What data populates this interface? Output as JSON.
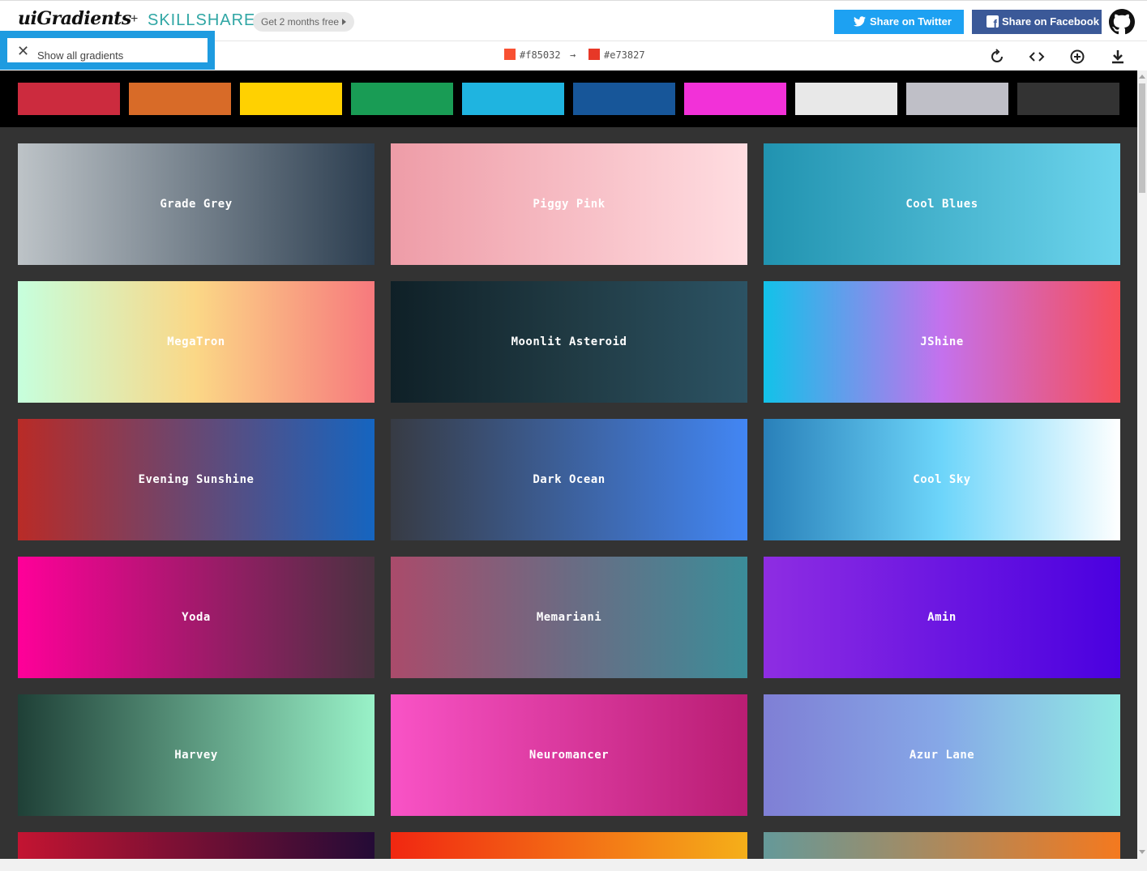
{
  "header": {
    "logo": "uiGradients",
    "plus": "+",
    "partner": "SKILLSHARE",
    "promo": "Get 2 months free",
    "twitter_label": "Share on Twitter",
    "facebook_label": "Share on Facebook"
  },
  "toolbar": {
    "show_all_label": "Show all gradients",
    "color_from": "#f85032",
    "color_arrow": "→",
    "color_to": "#e73827"
  },
  "filters": [
    {
      "color": "#cc2b3e"
    },
    {
      "color": "#d86b28"
    },
    {
      "color": "#ffd101"
    },
    {
      "color": "#199c55"
    },
    {
      "color": "#1fb4e0"
    },
    {
      "color": "#175699"
    },
    {
      "color": "#f231d8"
    },
    {
      "color": "#e8e8e8"
    },
    {
      "color": "#bfbfc7"
    },
    {
      "color": "#333333"
    }
  ],
  "gradients": [
    {
      "name": "Grade Grey",
      "from": "#bdc3c7",
      "to": "#2c3e50"
    },
    {
      "name": "Piggy Pink",
      "from": "#ee9ca7",
      "to": "#ffdde1"
    },
    {
      "name": "Cool Blues",
      "from": "#2193b0",
      "to": "#6dd5ed"
    },
    {
      "name": "MegaTron",
      "from": "#c6ffdd",
      "via": "#fbd786",
      "to": "#f7797d"
    },
    {
      "name": "Moonlit Asteroid",
      "from": "#0f2027",
      "via": "#203a43",
      "to": "#2c5364"
    },
    {
      "name": "JShine",
      "from": "#12c2e9",
      "via": "#c471ed",
      "to": "#f64f59"
    },
    {
      "name": "Evening Sunshine",
      "from": "#b92b27",
      "to": "#1565c0"
    },
    {
      "name": "Dark Ocean",
      "from": "#373b44",
      "to": "#4286f4"
    },
    {
      "name": "Cool Sky",
      "from": "#2980b9",
      "via": "#6dd5fa",
      "to": "#ffffff"
    },
    {
      "name": "Yoda",
      "from": "#ff0099",
      "to": "#493240"
    },
    {
      "name": "Memariani",
      "from": "#aa4b6b",
      "via": "#6b6b83",
      "to": "#3b8d99"
    },
    {
      "name": "Amin",
      "from": "#8e2de2",
      "to": "#4a00e0"
    },
    {
      "name": "Harvey",
      "from": "#1f4037",
      "to": "#99f2c8"
    },
    {
      "name": "Neuromancer",
      "from": "#f953c6",
      "to": "#b91d73"
    },
    {
      "name": "Azur Lane",
      "from": "#7f7fd5",
      "via": "#86a8e7",
      "to": "#91eae4"
    },
    {
      "name": "",
      "from": "#c31432",
      "to": "#240b36"
    },
    {
      "name": "",
      "from": "#f12711",
      "to": "#f5af19"
    },
    {
      "name": "",
      "from": "#659999",
      "to": "#f4791f"
    }
  ]
}
